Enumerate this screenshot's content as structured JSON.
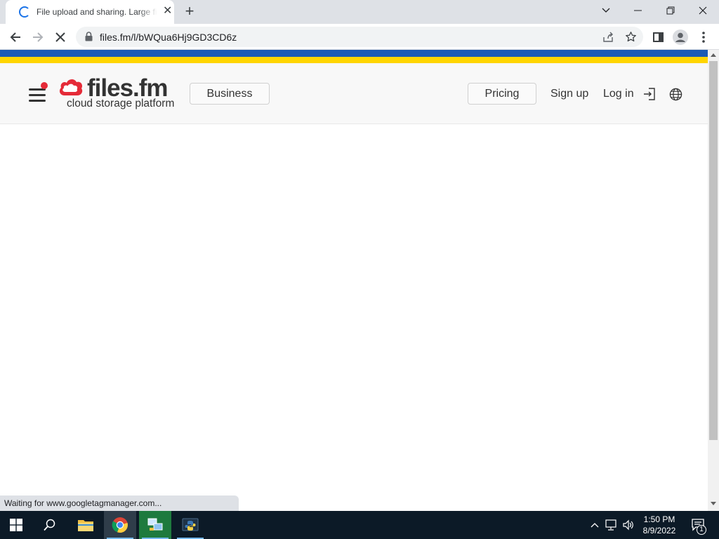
{
  "browser": {
    "tab_title": "File upload and sharing. Large files",
    "url": "files.fm/l/bWQua6Hj9GD3CD6z",
    "status_text": "Waiting for www.googletagmanager.com..."
  },
  "site": {
    "logo_text": "files.fm",
    "logo_subtitle": "cloud storage platform",
    "business_label": "Business",
    "pricing_label": "Pricing",
    "signup_label": "Sign up",
    "login_label": "Log in",
    "flag_colors": {
      "top": "#1b5ab5",
      "bottom": "#ffd500"
    },
    "brand_color": "#e52b38"
  },
  "taskbar": {
    "time": "1:50 PM",
    "date": "8/9/2022",
    "notification_count": "1"
  }
}
